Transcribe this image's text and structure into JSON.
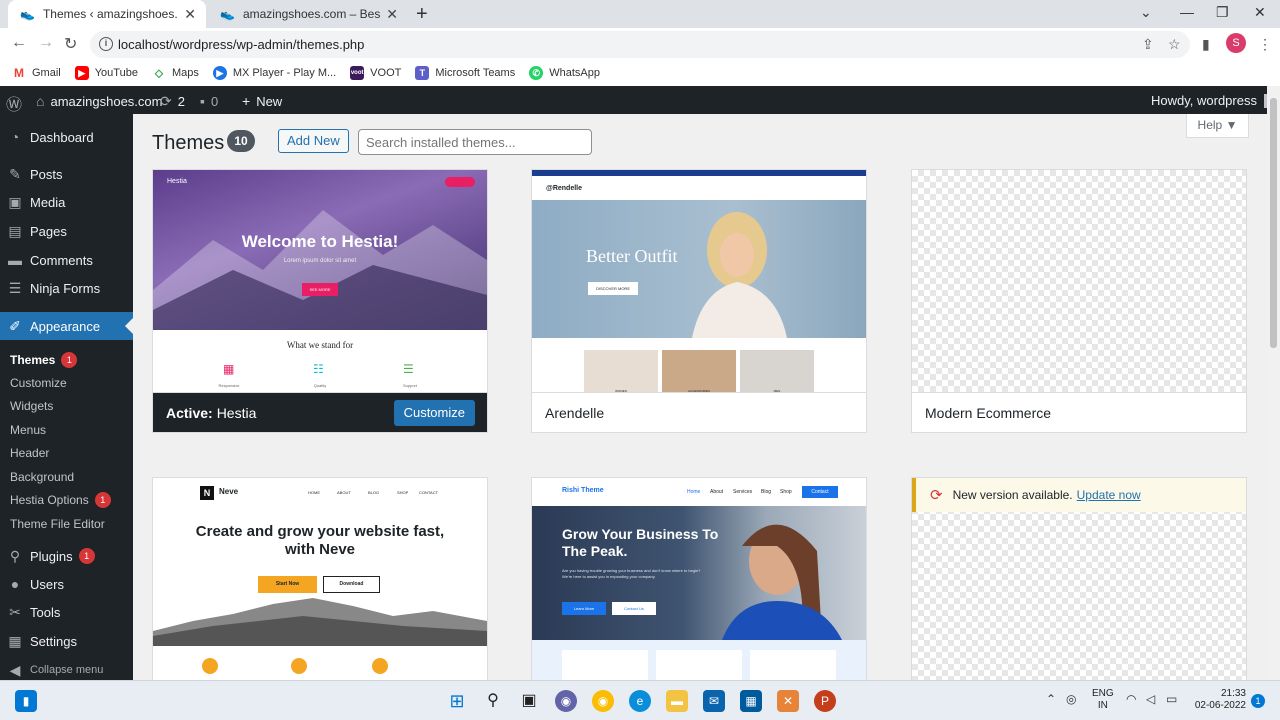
{
  "browser": {
    "tabs": [
      {
        "title": "Themes ‹ amazingshoes.com — W"
      },
      {
        "title": "amazingshoes.com – Best Shoes"
      }
    ],
    "url": "localhost/wordpress/wp-admin/themes.php",
    "profile_initial": "S",
    "bookmarks": [
      {
        "label": "Gmail",
        "icon": "gmail-icon"
      },
      {
        "label": "YouTube",
        "icon": "youtube-icon"
      },
      {
        "label": "Maps",
        "icon": "maps-icon"
      },
      {
        "label": "MX Player - Play M...",
        "icon": "mxplayer-icon"
      },
      {
        "label": "VOOT",
        "icon": "voot-icon"
      },
      {
        "label": "Microsoft Teams",
        "icon": "teams-icon"
      },
      {
        "label": "WhatsApp",
        "icon": "whatsapp-icon"
      }
    ]
  },
  "adminbar": {
    "site": "amazingshoes.com",
    "updates": "2",
    "comments": "0",
    "new": "New",
    "howdy": "Howdy, wordpress"
  },
  "sidebar": {
    "dashboard": "Dashboard",
    "posts": "Posts",
    "media": "Media",
    "pages": "Pages",
    "comments": "Comments",
    "ninja": "Ninja Forms",
    "appearance": "Appearance",
    "sub": {
      "themes": "Themes",
      "themes_badge": "1",
      "customize": "Customize",
      "widgets": "Widgets",
      "menus": "Menus",
      "header": "Header",
      "background": "Background",
      "hestia": "Hestia Options",
      "hestia_badge": "1",
      "editor": "Theme File Editor"
    },
    "plugins": "Plugins",
    "plugins_badge": "1",
    "users": "Users",
    "tools": "Tools",
    "settings": "Settings",
    "collapse": "Collapse menu"
  },
  "main": {
    "title": "Themes",
    "count": "10",
    "add_new": "Add New",
    "search_placeholder": "Search installed themes...",
    "help": "Help"
  },
  "themes": {
    "hestia": {
      "active_label": "Active:",
      "name": "Hestia",
      "customize": "Customize",
      "hero": "Welcome to Hestia!",
      "hero_sub": "Lorem ipsum dolor sit amet",
      "hero_btn": "SEE MORE",
      "stand": "What we stand for",
      "features": [
        "Responsive",
        "Quality",
        "Support"
      ],
      "brand": "Hestia"
    },
    "arendelle": {
      "name": "Arendelle",
      "logo": "@Rendelle",
      "hero": "Better Outfit",
      "hero_btn": "DISCOVER MORE",
      "cats": [
        "WOMEN",
        "ACCESSORIES",
        "MEN"
      ]
    },
    "modern": {
      "name": "Modern Ecommerce"
    },
    "neve": {
      "logo": "Neve",
      "nav": [
        "HOME",
        "ABOUT",
        "BLOG",
        "SHOP",
        "CONTACT"
      ],
      "hero": "Create and grow your website fast, with Neve",
      "start": "Start Now",
      "download": "Download"
    },
    "rishi": {
      "logo": "Rishi Theme",
      "nav": [
        "Home",
        "About",
        "Services",
        "Blog",
        "Shop"
      ],
      "contact": "Contact",
      "hero": "Grow Your Business To The Peak.",
      "body": "Are you having trouble growing your business and don't know where to begin? We're here to assist you in expanding your company.",
      "learn": "Learn More",
      "contact_us": "Contact Us"
    },
    "update_notice": {
      "text": "New version available.",
      "link": "Update now"
    }
  },
  "taskbar": {
    "lang": "ENG",
    "region": "IN",
    "time": "21:33",
    "date": "02-06-2022",
    "notif": "1"
  }
}
